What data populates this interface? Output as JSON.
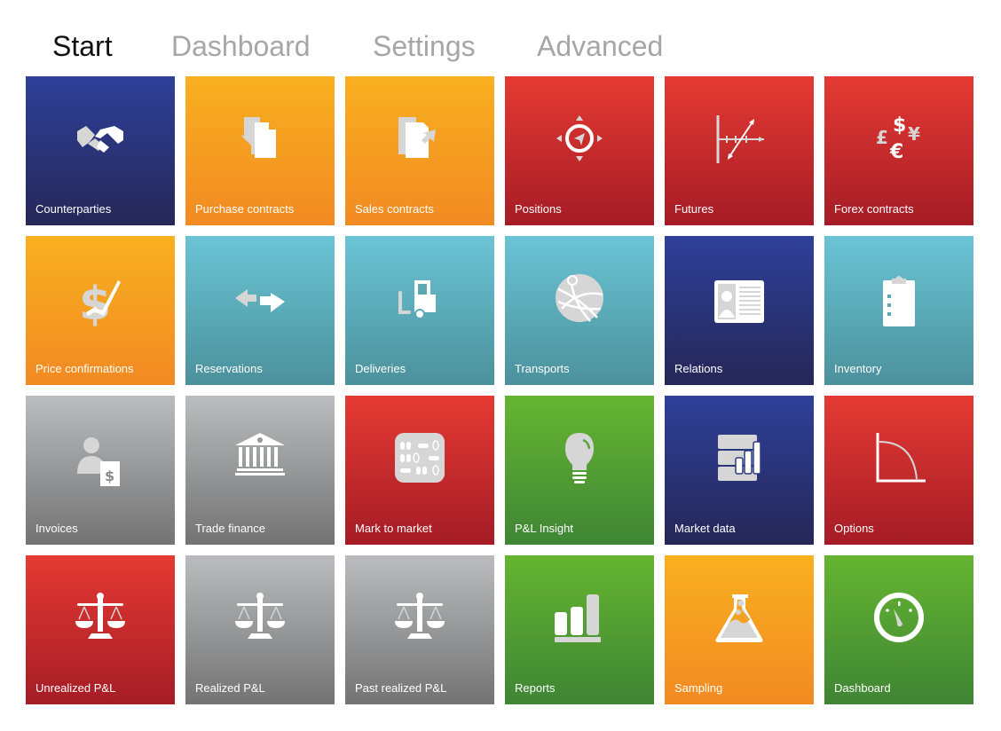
{
  "tabs": [
    {
      "label": "Start",
      "active": true
    },
    {
      "label": "Dashboard",
      "active": false
    },
    {
      "label": "Settings",
      "active": false
    },
    {
      "label": "Advanced",
      "active": false
    }
  ],
  "colors": {
    "blue": "#2f409a",
    "orange": "#f8b020",
    "red": "#e53a33",
    "teal": "#6bc4d4",
    "gray": "#bbbcbf",
    "green": "#66b531",
    "icon_white": "#ffffff",
    "icon_gray": "#d6d6d6"
  },
  "tiles": [
    {
      "label": "Counterparties",
      "color": "blue",
      "icon": "handshake-icon"
    },
    {
      "label": "Purchase contracts",
      "color": "orange",
      "icon": "document-import-icon"
    },
    {
      "label": "Sales contracts",
      "color": "orange",
      "icon": "document-export-icon"
    },
    {
      "label": "Positions",
      "color": "red",
      "icon": "compass-icon"
    },
    {
      "label": "Futures",
      "color": "red",
      "icon": "trend-axis-icon"
    },
    {
      "label": "Forex contracts",
      "color": "red",
      "icon": "currencies-icon"
    },
    {
      "label": "Price confirmations",
      "color": "orange",
      "icon": "dollar-check-icon"
    },
    {
      "label": "Reservations",
      "color": "teal",
      "icon": "exchange-arrows-icon"
    },
    {
      "label": "Deliveries",
      "color": "teal",
      "icon": "forklift-icon"
    },
    {
      "label": "Transports",
      "color": "teal",
      "icon": "globe-icon"
    },
    {
      "label": "Relations",
      "color": "blue",
      "icon": "id-card-icon"
    },
    {
      "label": "Inventory",
      "color": "teal",
      "icon": "clipboard-icon"
    },
    {
      "label": "Invoices",
      "color": "gray",
      "icon": "person-invoice-icon"
    },
    {
      "label": "Trade finance",
      "color": "gray",
      "icon": "bank-icon"
    },
    {
      "label": "Mark to market",
      "color": "red",
      "icon": "abacus-icon"
    },
    {
      "label": "P&L Insight",
      "color": "green",
      "icon": "lightbulb-icon"
    },
    {
      "label": "Market data",
      "color": "blue",
      "icon": "data-chart-icon"
    },
    {
      "label": "Options",
      "color": "red",
      "icon": "payoff-curve-icon"
    },
    {
      "label": "Unrealized P&L",
      "color": "red",
      "icon": "scales-icon"
    },
    {
      "label": "Realized P&L",
      "color": "gray",
      "icon": "scales-icon"
    },
    {
      "label": "Past realized P&L",
      "color": "gray",
      "icon": "scales-icon"
    },
    {
      "label": "Reports",
      "color": "green",
      "icon": "bar-chart-icon"
    },
    {
      "label": "Sampling",
      "color": "orange",
      "icon": "flask-icon"
    },
    {
      "label": "Dashboard",
      "color": "green",
      "icon": "gauge-icon"
    }
  ]
}
